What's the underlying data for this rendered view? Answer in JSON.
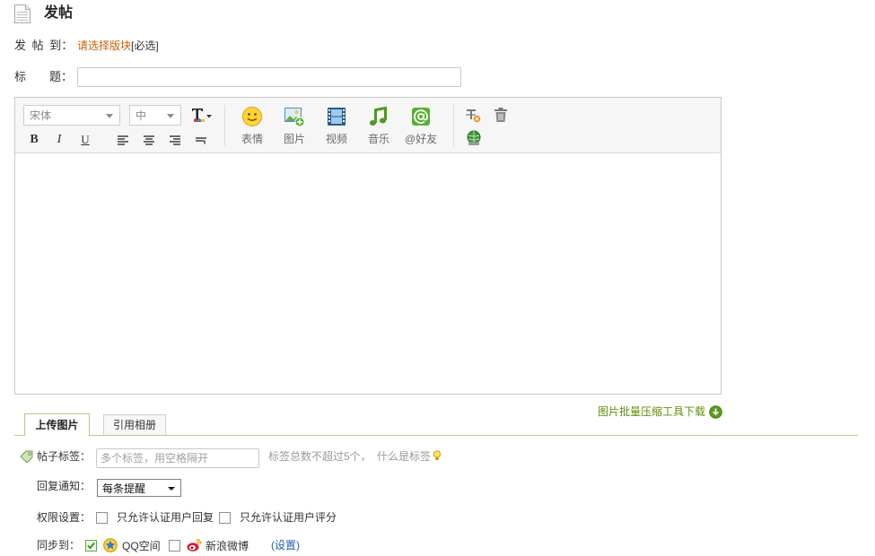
{
  "header": {
    "title": "发帖",
    "icon": "document-icon"
  },
  "post_to": {
    "label": "发 帖 到：",
    "link": "请选择版块",
    "required": "[必选]"
  },
  "title_field": {
    "label": "标　　题：",
    "value": ""
  },
  "editor": {
    "font_family": "宋体",
    "font_size": "中",
    "format": {
      "bold": "B",
      "italic": "I",
      "underline": "U"
    },
    "insert_buttons": [
      {
        "label": "表情",
        "icon": "smiley-icon"
      },
      {
        "label": "图片",
        "icon": "image-icon"
      },
      {
        "label": "视频",
        "icon": "video-icon"
      },
      {
        "label": "音乐",
        "icon": "music-icon"
      },
      {
        "label": "@好友",
        "icon": "at-friend-icon"
      }
    ],
    "extra_icons": [
      "clear-format-icon",
      "trash-icon",
      "globe-icon"
    ],
    "content": ""
  },
  "compress_tool": {
    "label": "图片批量压缩工具下载",
    "icon": "download-icon"
  },
  "tabs": [
    {
      "label": "上传图片",
      "active": true
    },
    {
      "label": "引用相册",
      "active": false
    }
  ],
  "tags": {
    "label": "帖子标签：",
    "placeholder": "多个标签，用空格隔开",
    "hint": "标签总数不超过5个，",
    "help_link": "什么是标签"
  },
  "reply_notify": {
    "label": "回复通知：",
    "selected": "每条提醒"
  },
  "permissions": {
    "label": "权限设置：",
    "options": [
      {
        "label": "只允许认证用户回复",
        "checked": false
      },
      {
        "label": "只允许认证用户评分",
        "checked": false
      }
    ]
  },
  "sync": {
    "label": "同步到：",
    "options": [
      {
        "label": "QQ空间",
        "checked": true,
        "icon": "qzone-icon"
      },
      {
        "label": "新浪微博",
        "checked": false,
        "icon": "weibo-icon"
      }
    ],
    "settings_link": "(设置)"
  },
  "colors": {
    "orange": "#c8600a",
    "green": "#5f8f0f",
    "blue": "#1f5fae"
  }
}
